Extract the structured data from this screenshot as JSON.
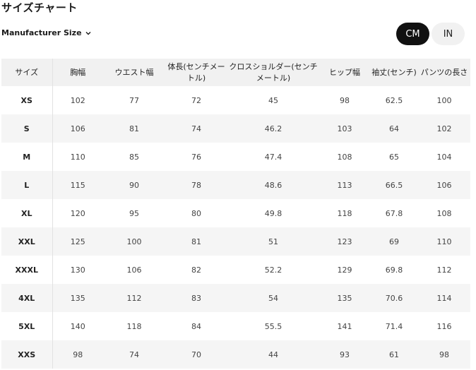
{
  "title": "サイズチャート",
  "size_selector": {
    "label": "Manufacturer Size",
    "icon": "chevron-down-icon"
  },
  "units": {
    "cm_label": "CM",
    "in_label": "IN",
    "selected": "CM"
  },
  "table": {
    "headers": [
      "サイズ",
      "胸幅",
      "ウエスト幅",
      "体長(センチメートル)",
      "クロスショルダー(センチメートル)",
      "ヒップ幅",
      "袖丈(センチ)",
      "パンツの長さ"
    ],
    "rows": [
      [
        "XS",
        "102",
        "77",
        "72",
        "45",
        "98",
        "62.5",
        "100"
      ],
      [
        "S",
        "106",
        "81",
        "74",
        "46.2",
        "103",
        "64",
        "102"
      ],
      [
        "M",
        "110",
        "85",
        "76",
        "47.4",
        "108",
        "65",
        "104"
      ],
      [
        "L",
        "115",
        "90",
        "78",
        "48.6",
        "113",
        "66.5",
        "106"
      ],
      [
        "XL",
        "120",
        "95",
        "80",
        "49.8",
        "118",
        "67.8",
        "108"
      ],
      [
        "XXL",
        "125",
        "100",
        "81",
        "51",
        "123",
        "69",
        "110"
      ],
      [
        "XXXL",
        "130",
        "106",
        "82",
        "52.2",
        "129",
        "69.8",
        "112"
      ],
      [
        "4XL",
        "135",
        "112",
        "83",
        "54",
        "135",
        "70.6",
        "114"
      ],
      [
        "5XL",
        "140",
        "118",
        "84",
        "55.5",
        "141",
        "71.4",
        "116"
      ],
      [
        "XXS",
        "98",
        "74",
        "70",
        "44",
        "93",
        "61",
        "98"
      ]
    ]
  }
}
